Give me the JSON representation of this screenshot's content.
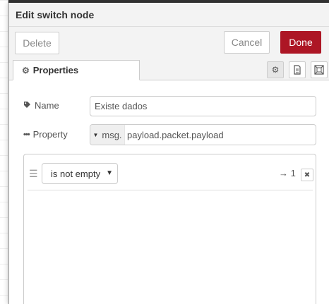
{
  "tray": {
    "title": "Edit switch node"
  },
  "toolbar": {
    "delete_label": "Delete",
    "cancel_label": "Cancel",
    "done_label": "Done"
  },
  "tabs": {
    "properties_label": "Properties"
  },
  "form": {
    "name_label": "Name",
    "name_value": "Existe dados",
    "property_label": "Property",
    "property_type": "msg.",
    "property_value": "payload.packet.payload"
  },
  "rules": [
    {
      "operator": "is not empty",
      "output": "→ 1"
    }
  ],
  "colors": {
    "done_button": "#ad1625"
  }
}
